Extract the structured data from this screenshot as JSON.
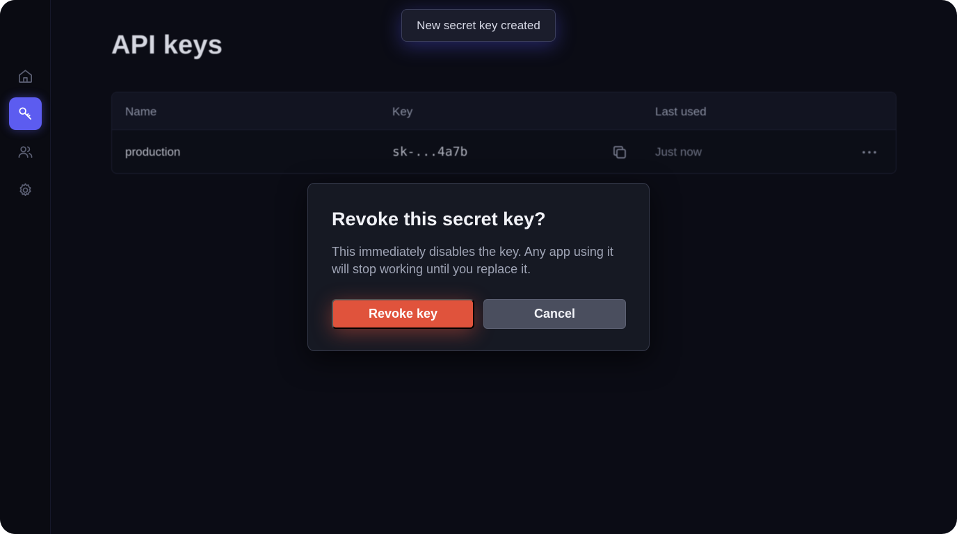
{
  "sidebar": {
    "items": [
      {
        "id": "home",
        "icon": "home-icon"
      },
      {
        "id": "api-keys",
        "icon": "key-icon",
        "active": true
      },
      {
        "id": "members",
        "icon": "users-icon"
      },
      {
        "id": "settings",
        "icon": "gear-icon"
      }
    ]
  },
  "page": {
    "title": "API keys"
  },
  "table": {
    "columns": [
      "Name",
      "Key",
      "Last used"
    ],
    "rows": [
      {
        "name": "production",
        "key": "sk-...4a7b",
        "last_used": "Just now"
      }
    ]
  },
  "toast": {
    "message": "New secret key created"
  },
  "dialog": {
    "title": "Revoke this secret key?",
    "body": "This immediately disables the key. Any app using it will stop working until you replace it.",
    "confirm_label": "Revoke key",
    "cancel_label": "Cancel"
  },
  "colors": {
    "accent": "#5c5cf0",
    "danger": "#e0533c",
    "background": "#0b0c15"
  }
}
